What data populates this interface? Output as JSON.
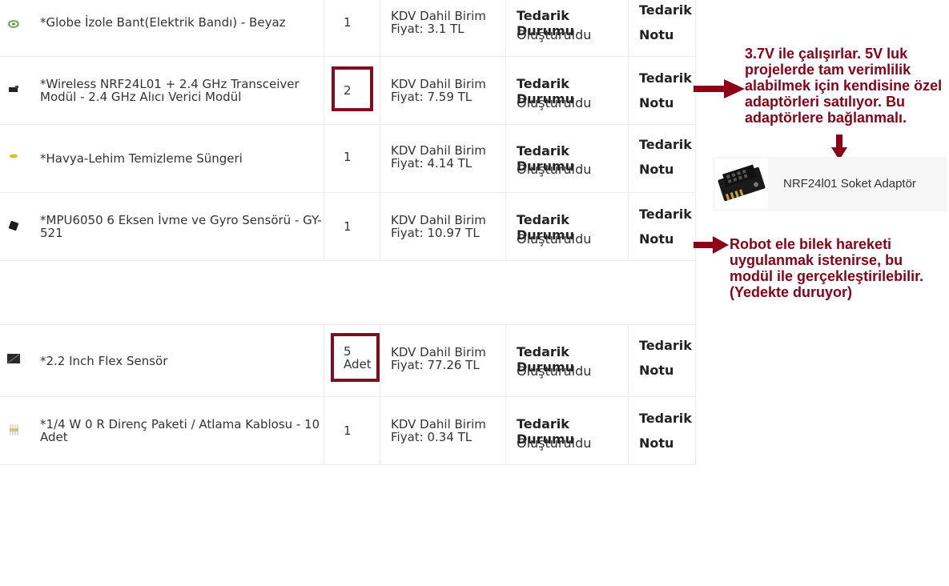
{
  "rows": [
    {
      "name": "*Globe İzole Bant(Elektrik Bandı) - Beyaz",
      "qty": "1",
      "price_line1": "KDV Dahil Birim",
      "price_line2": "Fiyat: 3.1 TL",
      "status_label": "Tedarik Durumu",
      "status_value": "Oluşturuldu",
      "note_line1": "Tedarik",
      "note_line2": "Notu",
      "thumb_icon": "tape-roll-icon"
    },
    {
      "name": "*Wireless NRF24L01 + 2.4 GHz Transceiver Modül - 2.4 GHz Alıcı Verici Modül",
      "qty": "2",
      "price_line1": "KDV Dahil Birim",
      "price_line2": "Fiyat: 7.59 TL",
      "status_label": "Tedarik Durumu",
      "status_value": "Oluşturuldu",
      "note_line1": "Tedarik",
      "note_line2": "Notu",
      "thumb_icon": "rf-module-icon"
    },
    {
      "name": "*Havya-Lehim Temizleme Süngeri",
      "qty": "1",
      "price_line1": "KDV Dahil Birim",
      "price_line2": "Fiyat: 4.14 TL",
      "status_label": "Tedarik Durumu",
      "status_value": "Oluşturuldu",
      "note_line1": "Tedarik",
      "note_line2": "Notu",
      "thumb_icon": "sponge-icon"
    },
    {
      "name": "*MPU6050 6 Eksen İvme ve Gyro Sensörü - GY-521",
      "qty": "1",
      "price_line1": "KDV Dahil Birim",
      "price_line2": "Fiyat: 10.97 TL",
      "status_label": "Tedarik Durumu",
      "status_value": "Oluşturuldu",
      "note_line1": "Tedarik",
      "note_line2": "Notu",
      "thumb_icon": "sensor-board-icon"
    },
    {
      "name": "*2.2 Inch Flex Sensör",
      "qty": "5\nAdet",
      "price_line1": "KDV Dahil Birim",
      "price_line2": "Fiyat: 77.26 TL",
      "status_label": "Tedarik Durumu",
      "status_value": "Oluşturuldu",
      "note_line1": "Tedarik",
      "note_line2": "Notu",
      "thumb_icon": "flex-sensor-icon"
    },
    {
      "name": "*1/4 W 0 R Direnç Paketi / Atlama Kablosu - 10 Adet",
      "qty": "1",
      "price_line1": "KDV Dahil Birim",
      "price_line2": "Fiyat: 0.34 TL",
      "status_label": "Tedarik Durumu",
      "status_value": "Oluşturuldu",
      "note_line1": "Tedarik",
      "note_line2": "Notu",
      "thumb_icon": "resistor-pack-icon"
    }
  ],
  "annotations": {
    "nrf_note": "3.7V ile çalışırlar. 5V luk projelerde tam verimlilik alabilmek için kendisine özel adaptörleri satılıyor. Bu adaptörlere bağlanmalı.",
    "mpu_note": "Robot ele bilek hareketi uygulanmak istenirse, bu modül ile gerçekleştirilebilir. (Yedekte duruyor)",
    "adapter_label": "NRF24l01 Soket Adaptör",
    "adapter_icon": "socket-adapter-icon",
    "accent_color": "#8b0016"
  }
}
